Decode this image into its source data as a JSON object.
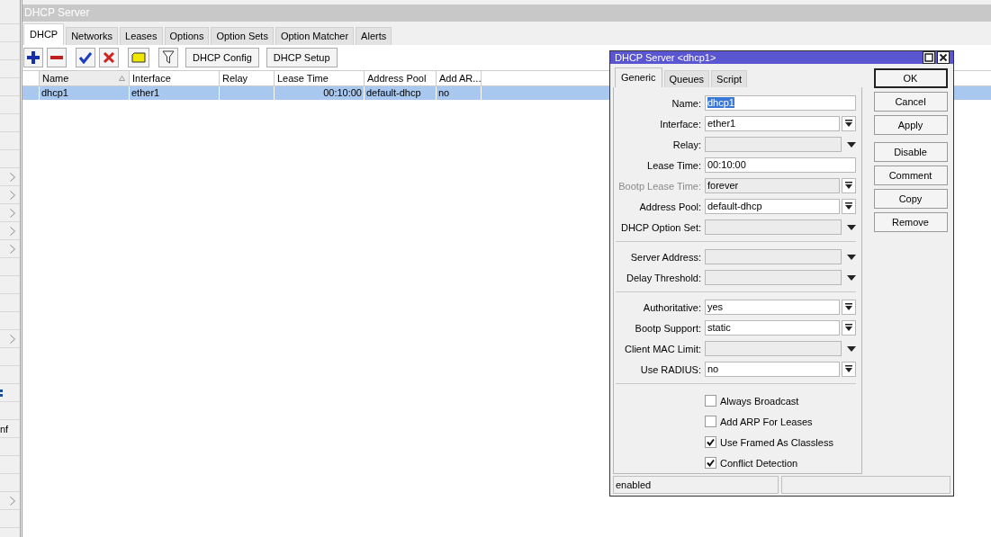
{
  "sidebar": {
    "items": [
      {
        "kind": "plain"
      },
      {
        "kind": "plain"
      },
      {
        "kind": "plain"
      },
      {
        "kind": "plain"
      },
      {
        "kind": "plain"
      },
      {
        "kind": "plain"
      },
      {
        "kind": "plain"
      },
      {
        "kind": "plain"
      },
      {
        "kind": "plain"
      },
      {
        "kind": "submenu"
      },
      {
        "kind": "submenu"
      },
      {
        "kind": "submenu"
      },
      {
        "kind": "submenu"
      },
      {
        "kind": "submenu"
      },
      {
        "kind": "plain"
      },
      {
        "kind": "plain"
      },
      {
        "kind": "plain"
      },
      {
        "kind": "plain"
      },
      {
        "kind": "submenu"
      },
      {
        "kind": "plain"
      },
      {
        "kind": "plain"
      },
      {
        "kind": "icon"
      },
      {
        "kind": "plain"
      },
      {
        "kind": "text",
        "label": "nf"
      },
      {
        "kind": "plain"
      },
      {
        "kind": "plain"
      },
      {
        "kind": "plain"
      },
      {
        "kind": "submenu"
      },
      {
        "kind": "plain"
      }
    ]
  },
  "window": {
    "title": "DHCP Server",
    "tabs": [
      {
        "label": "DHCP",
        "selected": true
      },
      {
        "label": "Networks",
        "selected": false
      },
      {
        "label": "Leases",
        "selected": false
      },
      {
        "label": "Options",
        "selected": false
      },
      {
        "label": "Option Sets",
        "selected": false
      },
      {
        "label": "Option Matcher",
        "selected": false
      },
      {
        "label": "Alerts",
        "selected": false
      }
    ],
    "toolbar": [
      {
        "kind": "add"
      },
      {
        "kind": "remove"
      },
      {
        "kind": "enable"
      },
      {
        "kind": "disable"
      },
      {
        "kind": "comment"
      },
      {
        "kind": "filter"
      },
      {
        "kind": "text",
        "label": "DHCP Config"
      },
      {
        "kind": "text",
        "label": "DHCP Setup"
      }
    ],
    "table": {
      "columns": [
        {
          "label": "Name",
          "sorted": true
        },
        {
          "label": "Interface",
          "sorted": false
        },
        {
          "label": "Relay",
          "sorted": false
        },
        {
          "label": "Lease Time",
          "sorted": false
        },
        {
          "label": "Address Pool",
          "sorted": false
        },
        {
          "label": "Add AR...",
          "sorted": false
        }
      ],
      "rows": [
        {
          "selected": true,
          "cells": [
            "dhcp1",
            "ether1",
            "",
            "00:10:00",
            "default-dhcp",
            "no"
          ]
        }
      ]
    }
  },
  "dialog": {
    "title": "DHCP Server <dhcp1>",
    "tabs": [
      {
        "label": "Generic",
        "selected": true
      },
      {
        "label": "Queues",
        "selected": false
      },
      {
        "label": "Script",
        "selected": false
      }
    ],
    "groups": [
      [
        {
          "label": "Name:",
          "kind": "text",
          "value": "dhcp1",
          "selected": true,
          "disabled": false
        },
        {
          "label": "Interface:",
          "kind": "combo",
          "value": "ether1",
          "selected": false,
          "disabled": false
        },
        {
          "label": "Relay:",
          "kind": "optional",
          "selected": false,
          "disabled": false
        },
        {
          "label": "Lease Time:",
          "kind": "text",
          "value": "00:10:00",
          "selected": false,
          "disabled": false
        },
        {
          "label": "Bootp Lease Time:",
          "kind": "combo",
          "value": "forever",
          "selected": false,
          "disabled": true
        },
        {
          "label": "Address Pool:",
          "kind": "combo",
          "value": "default-dhcp",
          "selected": false,
          "disabled": false
        },
        {
          "label": "DHCP Option Set:",
          "kind": "optional",
          "selected": false,
          "disabled": false
        }
      ],
      [
        {
          "label": "Server Address:",
          "kind": "optional",
          "selected": false,
          "disabled": false
        },
        {
          "label": "Delay Threshold:",
          "kind": "optional",
          "selected": false,
          "disabled": false
        }
      ],
      [
        {
          "label": "Authoritative:",
          "kind": "combo",
          "value": "yes",
          "selected": false,
          "disabled": false
        },
        {
          "label": "Bootp Support:",
          "kind": "combo",
          "value": "static",
          "selected": false,
          "disabled": false
        },
        {
          "label": "Client MAC Limit:",
          "kind": "optional",
          "selected": false,
          "disabled": false
        },
        {
          "label": "Use RADIUS:",
          "kind": "combo",
          "value": "no",
          "selected": false,
          "disabled": false
        }
      ]
    ],
    "checkboxes": [
      {
        "label": "Always Broadcast",
        "checked": false
      },
      {
        "label": "Add ARP For Leases",
        "checked": false
      },
      {
        "label": "Use Framed As Classless",
        "checked": true
      },
      {
        "label": "Conflict Detection",
        "checked": true
      }
    ],
    "buttons": [
      {
        "label": "OK",
        "default": true
      },
      {
        "label": "Cancel",
        "default": false
      },
      {
        "label": "Apply",
        "default": false
      },
      {
        "label": "Disable",
        "default": false
      },
      {
        "label": "Comment",
        "default": false
      },
      {
        "label": "Copy",
        "default": false
      },
      {
        "label": "Remove",
        "default": false
      }
    ],
    "status_bar": [
      "enabled"
    ]
  }
}
